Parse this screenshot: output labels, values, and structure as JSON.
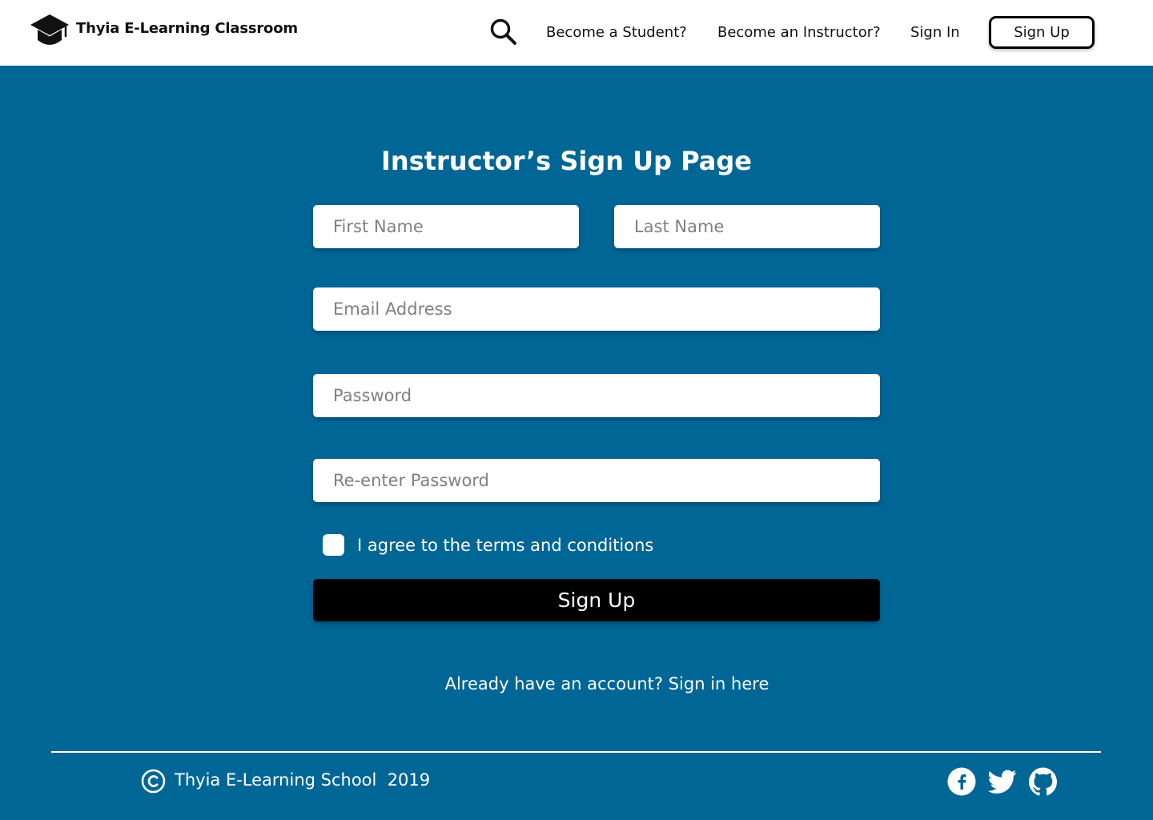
{
  "header": {
    "brand": "Thyia E-Learning Classroom",
    "logo_icon": "graduation-cap-icon",
    "search_icon": "search-icon",
    "nav": {
      "become_student": "Become a Student?",
      "become_instructor": "Become an Instructor?",
      "sign_in": "Sign In",
      "sign_up": "Sign Up"
    }
  },
  "form": {
    "title": "Instructor’s Sign Up Page",
    "first_name_placeholder": "First Name",
    "last_name_placeholder": "Last Name",
    "email_placeholder": "Email Address",
    "password_placeholder": "Password",
    "reenter_password_placeholder": "Re-enter Password",
    "terms_label": "I agree to the terms and conditions",
    "terms_checked": false,
    "submit_label": "Sign Up",
    "signin_prompt": "Already have an account? Sign in here"
  },
  "footer": {
    "copyright_text": "Thyia E-Learning School  2019",
    "social_icons": [
      "facebook-icon",
      "twitter-icon",
      "github-icon"
    ]
  },
  "colors": {
    "page_background": "#006696",
    "header_background": "#ffffff",
    "button_primary": "#000000"
  }
}
